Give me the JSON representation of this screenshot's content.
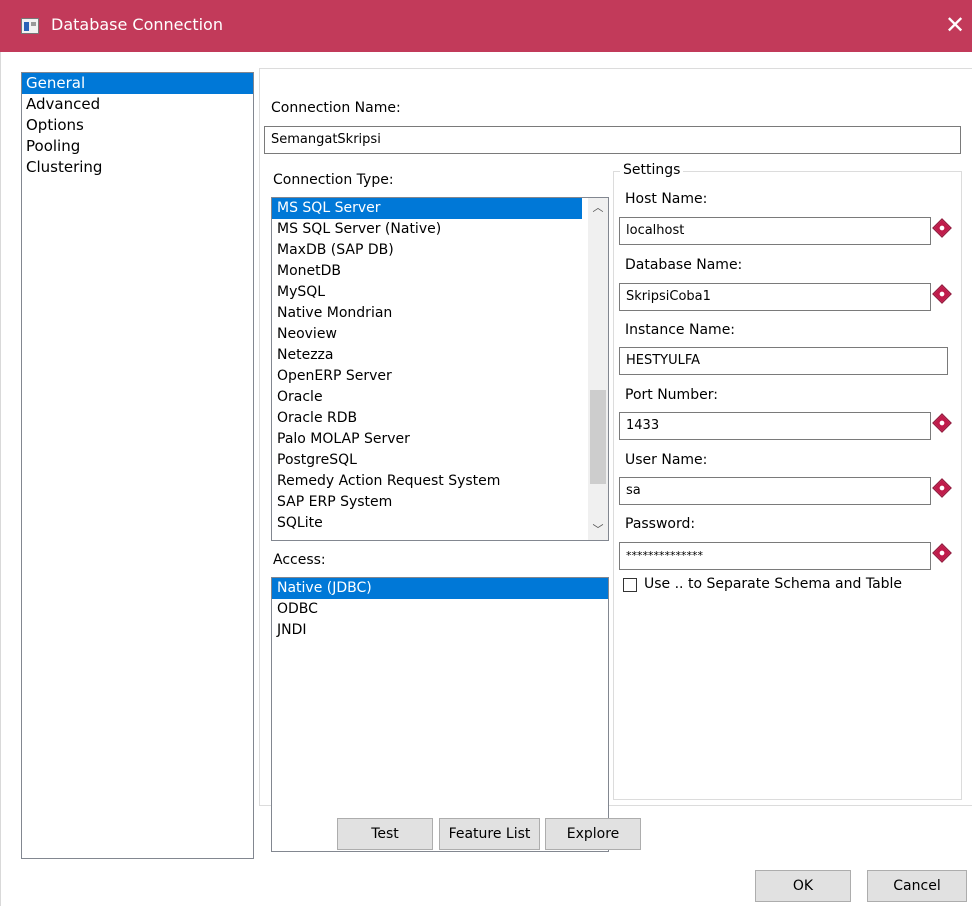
{
  "window": {
    "title": "Database Connection"
  },
  "nav": {
    "items": [
      "General",
      "Advanced",
      "Options",
      "Pooling",
      "Clustering"
    ],
    "selected": 0
  },
  "connection_name": {
    "label": "Connection Name:",
    "value": "SemangatSkripsi"
  },
  "connection_type": {
    "label": "Connection Type:",
    "items": [
      "MS SQL Server",
      "MS SQL Server (Native)",
      "MaxDB (SAP DB)",
      "MonetDB",
      "MySQL",
      "Native Mondrian",
      "Neoview",
      "Netezza",
      "OpenERP Server",
      "Oracle",
      "Oracle RDB",
      "Palo MOLAP Server",
      "PostgreSQL",
      "Remedy Action Request System",
      "SAP ERP System",
      "SQLite"
    ],
    "selected": 0
  },
  "access": {
    "label": "Access:",
    "items": [
      "Native (JDBC)",
      "ODBC",
      "JNDI"
    ],
    "selected": 0
  },
  "settings": {
    "legend": "Settings",
    "host_name": {
      "label": "Host Name:",
      "value": "localhost"
    },
    "database_name": {
      "label": "Database Name:",
      "value": "SkripsiCoba1"
    },
    "instance_name": {
      "label": "Instance Name:",
      "value": "HESTYULFA"
    },
    "port_number": {
      "label": "Port Number:",
      "value": "1433"
    },
    "user_name": {
      "label": "User Name:",
      "value": "sa"
    },
    "password": {
      "label": "Password:",
      "value": "**************"
    },
    "separate_schema": {
      "label": "Use .. to Separate Schema and Table",
      "checked": false
    }
  },
  "buttons": {
    "test": "Test",
    "feature_list": "Feature List",
    "explore": "Explore",
    "ok": "OK",
    "cancel": "Cancel"
  },
  "icons": {
    "app": "database-connection-icon",
    "close": "close-icon",
    "required": "required-field-icon",
    "scroll_up": "chevron-up-icon",
    "scroll_down": "chevron-down-icon"
  },
  "colors": {
    "titlebar": "#c23a5a",
    "selection": "#0078d7",
    "required": "#c01c4b"
  }
}
